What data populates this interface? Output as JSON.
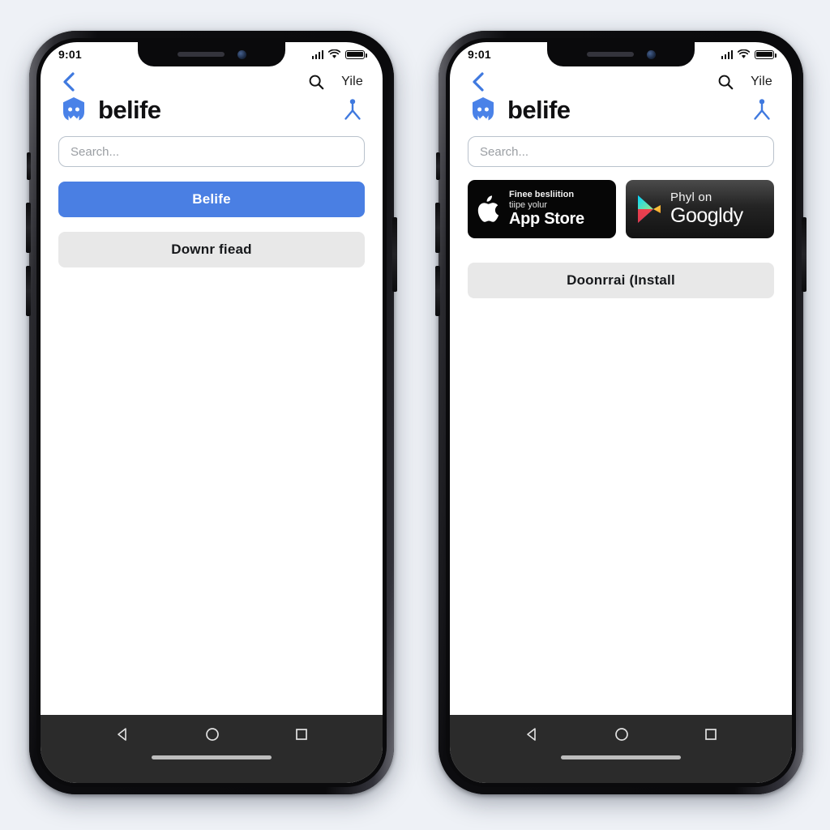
{
  "theme": {
    "page_background": "#eef1f6",
    "primary_blue": "#4a7fe3",
    "logo_blue": "#4a82e8",
    "secondary_gray": "#e8e8e8",
    "navbar_dark": "#2b2b2b"
  },
  "status_bar": {
    "time": "9:01",
    "signal_icon": "cellular-signal-icon",
    "wifi_icon": "wifi-icon",
    "battery_icon": "battery-full-icon"
  },
  "header": {
    "back_icon": "back-chevron-icon",
    "search_icon": "search-icon",
    "menu_label": "Yile",
    "brand_name": "belife",
    "brand_logo_icon": "belife-robot-logo-icon",
    "person_icon": "person-share-icon"
  },
  "search": {
    "placeholder": "Search...",
    "value": ""
  },
  "phone_left": {
    "primary_button_label": "Belife",
    "secondary_button_label": "Downr fiead"
  },
  "phone_right": {
    "badges": [
      {
        "name": "apple-app-store-badge",
        "icon": "apple-logo-icon",
        "line1": "Finee besliition",
        "line2": "tiipe yolur",
        "line3": "App Store"
      },
      {
        "name": "google-play-badge",
        "icon": "google-play-triangle-icon",
        "line1": "Phyl on",
        "line2": "Googldy"
      }
    ],
    "secondary_button_label": "Doonrrai (Install"
  },
  "android_nav": {
    "back_icon": "android-back-triangle-icon",
    "home_icon": "android-home-circle-icon",
    "recents_icon": "android-recents-square-icon",
    "home_indicator": "home-indicator-bar"
  }
}
